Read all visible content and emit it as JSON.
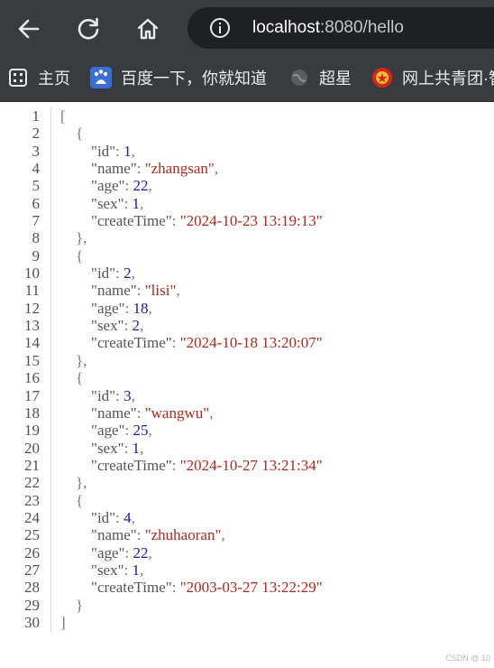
{
  "browser": {
    "url_host": "localhost",
    "url_rest": ":8080/hello",
    "icons": {
      "back": "back-arrow-icon",
      "reload": "reload-icon",
      "home": "home-icon",
      "info": "info-icon"
    }
  },
  "bookmarks": [
    {
      "label": "主页",
      "icon": "apps-icon"
    },
    {
      "label": "百度一下，你就知道",
      "icon": "baidu-icon"
    },
    {
      "label": "超星",
      "icon": "globe-icon"
    },
    {
      "label": "网上共青团·智",
      "icon": "league-badge-icon"
    }
  ],
  "json_view": {
    "records": [
      {
        "id": "1",
        "name": "zhangsan",
        "age": "22",
        "sex": "1",
        "createTime": "2024-10-23 13:19:13"
      },
      {
        "id": "2",
        "name": "lisi",
        "age": "18",
        "sex": "2",
        "createTime": "2024-10-18 13:20:07"
      },
      {
        "id": "3",
        "name": "wangwu",
        "age": "25",
        "sex": "1",
        "createTime": "2024-10-27 13:21:34"
      },
      {
        "id": "4",
        "name": "zhuhaoran",
        "age": "22",
        "sex": "1",
        "createTime": "2003-03-27 13:22:29"
      }
    ]
  },
  "watermark": "CSDN @  10"
}
